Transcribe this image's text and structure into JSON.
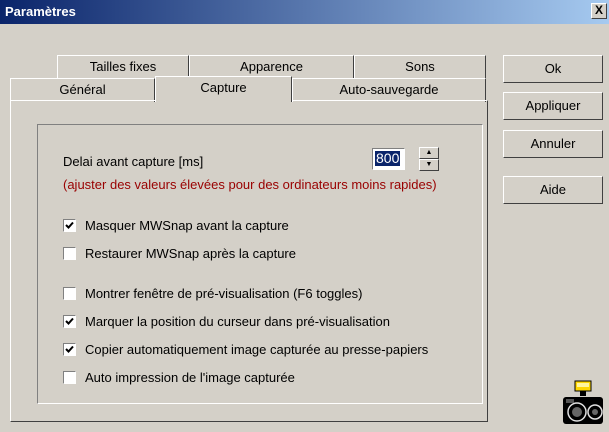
{
  "window": {
    "title": "Paramètres",
    "close_label": "X"
  },
  "tabs_back": [
    {
      "label": "Tailles fixes"
    },
    {
      "label": "Apparence"
    },
    {
      "label": "Sons"
    }
  ],
  "tabs_front": [
    {
      "label": "Général"
    },
    {
      "label": "Capture",
      "active": true
    },
    {
      "label": "Auto-sauvegarde"
    }
  ],
  "capture": {
    "delay_label": "Delai avant capture [ms]",
    "delay_value": "800",
    "delay_hint": "(ajuster des valeurs élevées pour des ordinateurs moins rapides)",
    "options": [
      {
        "label": "Masquer MWSnap avant la capture",
        "checked": true
      },
      {
        "label": "Restaurer MWSnap après la capture",
        "checked": false
      },
      {
        "label": "Montrer fenêtre de pré-visualisation (F6 toggles)",
        "checked": false
      },
      {
        "label": "Marquer la position du curseur dans pré-visualisation",
        "checked": true
      },
      {
        "label": "Copier automatiquement image capturée au presse-papiers",
        "checked": true
      },
      {
        "label": "Auto impression de l'image capturée",
        "checked": false
      }
    ]
  },
  "buttons": {
    "ok": "Ok",
    "apply": "Appliquer",
    "cancel": "Annuler",
    "help": "Aide"
  },
  "icons": {
    "camera": "camera-icon",
    "flash": "flash-icon"
  },
  "colors": {
    "titlebar_start": "#0a246a",
    "titlebar_end": "#a6caf0",
    "hint_text": "#990000",
    "selection": "#0a246a"
  }
}
